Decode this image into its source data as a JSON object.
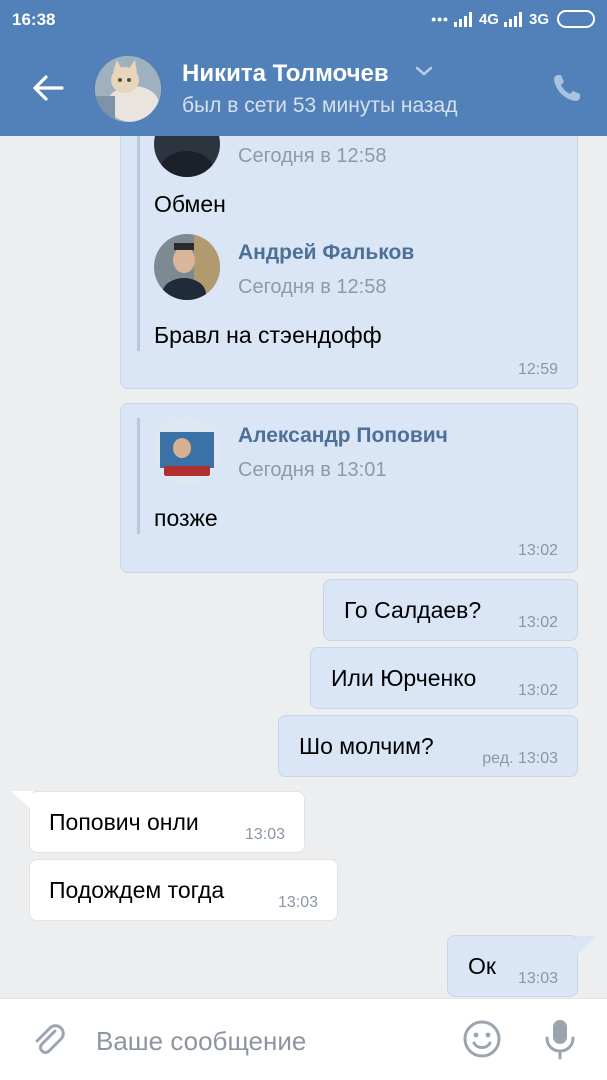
{
  "status_bar": {
    "time": "16:38",
    "network_4g": "4G",
    "network_3g": "3G"
  },
  "header": {
    "contact_name": "Никита Толмочев",
    "contact_status": "был в сети 53 минуты назад"
  },
  "messages": {
    "msg1": {
      "fwd_a_date": "Сегодня в 12:58",
      "fwd_a_text": "Обмен",
      "fwd_b_name": "Андрей Фальков",
      "fwd_b_date": "Сегодня в 12:58",
      "fwd_b_text": "Бравл на стэендофф",
      "time": "12:59"
    },
    "msg2": {
      "fwd_name": "Александр Попович",
      "fwd_date": "Сегодня в 13:01",
      "fwd_text": "позже",
      "time": "13:02"
    },
    "msg3": {
      "text": "Го Салдаев?",
      "time": "13:02"
    },
    "msg4": {
      "text": "Или Юрченко",
      "time": "13:02"
    },
    "msg5": {
      "text": "Шо молчим?",
      "time": "ред. 13:03"
    },
    "msg6": {
      "text": "Попович онли",
      "time": "13:03"
    },
    "msg7": {
      "text": "Подождем тогда",
      "time": "13:03"
    },
    "msg8": {
      "text": "Ок",
      "time": "13:03"
    }
  },
  "composer": {
    "placeholder": "Ваше сообщение"
  },
  "icons": {
    "back": "back-arrow-icon",
    "dropdown": "chevron-down-icon",
    "call": "phone-icon",
    "attach": "paperclip-icon",
    "emoji": "smiley-icon",
    "mic": "microphone-icon"
  },
  "colors": {
    "header_bg": "#5181b8",
    "outgoing_bubble": "#dae6f5",
    "incoming_bubble": "#ffffff",
    "chat_bg": "#edeef0",
    "forward_name": "#4e7097"
  }
}
